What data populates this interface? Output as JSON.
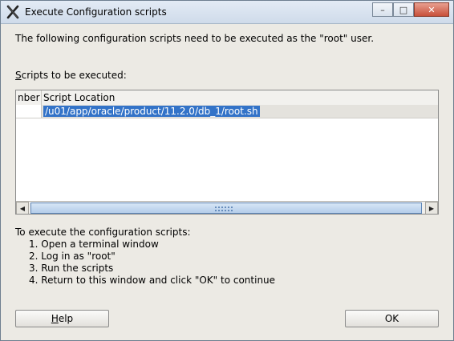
{
  "window": {
    "title": "Execute Configuration scripts",
    "controls": {
      "minimize": "–",
      "maximize": "□",
      "close": "✕"
    }
  },
  "intro": "The following configuration scripts need to be executed as the \"root\" user.",
  "scripts_label": "Scripts to be executed:",
  "table": {
    "columns": [
      "nber",
      "Script Location"
    ],
    "rows": [
      {
        "number": "",
        "location": "/u01/app/oracle/product/11.2.0/db_1/root.sh"
      }
    ]
  },
  "scrollbar": {
    "left_arrow": "◀",
    "right_arrow": "▶"
  },
  "instructions": {
    "heading": "To execute the configuration scripts:",
    "steps": [
      "1. Open a terminal window",
      "2. Log in as \"root\"",
      "3. Run the scripts",
      "4. Return to this window and click \"OK\" to continue"
    ]
  },
  "buttons": {
    "help": "Help",
    "ok": "OK"
  },
  "colors": {
    "selection": "#3373c8",
    "background": "#eceae4"
  }
}
